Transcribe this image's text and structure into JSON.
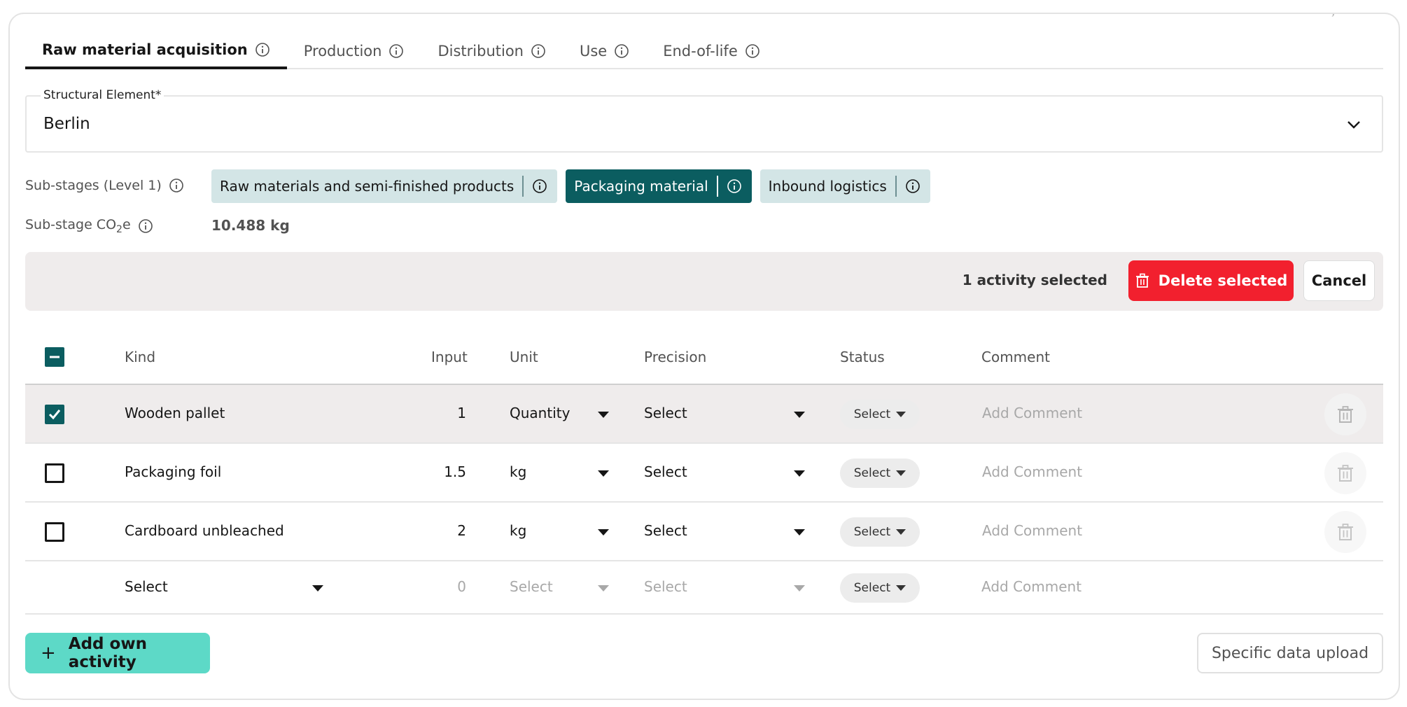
{
  "tabs": [
    {
      "label": "Raw material acquisition",
      "active": true
    },
    {
      "label": "Production",
      "active": false
    },
    {
      "label": "Distribution",
      "active": false
    },
    {
      "label": "Use",
      "active": false
    },
    {
      "label": "End-of-life",
      "active": false
    }
  ],
  "structural_element": {
    "label": "Structural Element*",
    "value": "Berlin"
  },
  "substages": {
    "label": "Sub-stages (Level 1)",
    "chips": [
      {
        "label": "Raw materials and semi-finished products",
        "active": false
      },
      {
        "label": "Packaging material",
        "active": true
      },
      {
        "label": "Inbound logistics",
        "active": false
      }
    ]
  },
  "co2": {
    "label_prefix": "Sub-stage CO",
    "label_sub": "2",
    "label_suffix": "e",
    "value": "10.488 kg"
  },
  "selection_bar": {
    "count_text": "1 activity selected",
    "delete_label": "Delete selected",
    "cancel_label": "Cancel"
  },
  "table": {
    "headers": {
      "kind": "Kind",
      "input": "Input",
      "unit": "Unit",
      "precision": "Precision",
      "status": "Status",
      "comment": "Comment"
    },
    "rows": [
      {
        "kind": "Wooden pallet",
        "input": "1",
        "unit": "Quantity",
        "precision": "Select",
        "status": "Select",
        "comment_placeholder": "Add Comment",
        "checked": true
      },
      {
        "kind": "Packaging foil",
        "input": "1.5",
        "unit": "kg",
        "precision": "Select",
        "status": "Select",
        "comment_placeholder": "Add Comment",
        "checked": false
      },
      {
        "kind": "Cardboard unbleached",
        "input": "2",
        "unit": "kg",
        "precision": "Select",
        "status": "Select",
        "comment_placeholder": "Add Comment",
        "checked": false
      }
    ],
    "new_row": {
      "kind": "Select",
      "input": "0",
      "unit": "Select",
      "precision": "Select",
      "status": "Select",
      "comment_placeholder": "Add Comment"
    }
  },
  "buttons": {
    "add_own_activity": "Add own activity",
    "add_plus": "+",
    "specific_upload": "Specific data upload"
  },
  "colors": {
    "accent_teal": "#0b5d60",
    "chip_bg": "#d3e5e6",
    "delete_red": "#f2202e",
    "add_green": "#5dd9c7",
    "selected_row_bg": "#efecec"
  },
  "icons": [
    "info-icon",
    "chevron-down-icon",
    "trash-icon",
    "checkbox-checked-icon",
    "checkbox-indeterminate-icon",
    "caret-down-icon",
    "plus-icon"
  ]
}
